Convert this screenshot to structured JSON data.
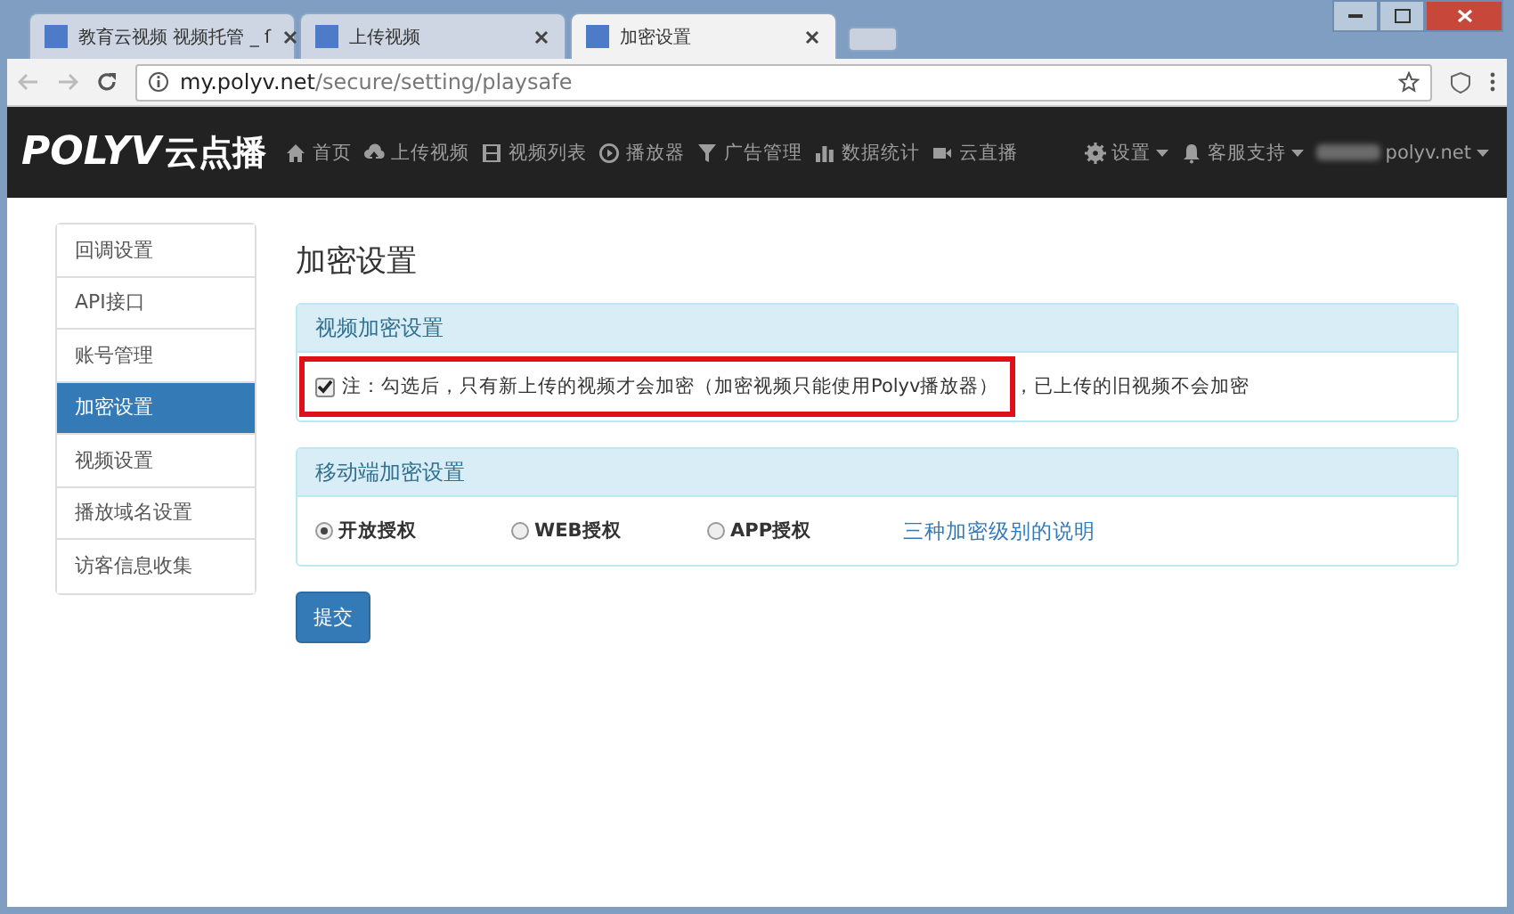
{
  "browser": {
    "tabs": [
      {
        "title": "教育云视频 视频托管 _ ſ",
        "selected": false
      },
      {
        "title": "上传视频",
        "selected": false
      },
      {
        "title": "加密设置",
        "selected": true
      }
    ],
    "address": {
      "host": "my.polyv.net",
      "path": "/secure/setting/playsafe"
    }
  },
  "navbar": {
    "logo": "POLYV",
    "logo_suffix": "云点播",
    "items": [
      {
        "label": "首页"
      },
      {
        "label": "上传视频"
      },
      {
        "label": "视频列表"
      },
      {
        "label": "播放器"
      },
      {
        "label": "广告管理"
      },
      {
        "label": "数据统计"
      },
      {
        "label": "云直播"
      }
    ],
    "right": [
      {
        "label": "设置"
      },
      {
        "label": "客服支持"
      },
      {
        "label": "polyv.net"
      }
    ]
  },
  "sidebar": {
    "items": [
      {
        "label": "回调设置",
        "selected": false
      },
      {
        "label": "API接口",
        "selected": false
      },
      {
        "label": "账号管理",
        "selected": false
      },
      {
        "label": "加密设置",
        "selected": true
      },
      {
        "label": "视频设置",
        "selected": false
      },
      {
        "label": "播放域名设置",
        "selected": false
      },
      {
        "label": "访客信息收集",
        "selected": false
      }
    ]
  },
  "page_title": "加密设置",
  "panels": [
    {
      "title": "视频加密设置",
      "kind": "checkbox",
      "checked": true,
      "highlighted": true,
      "note": "注：勾选后，只有新上传的视频才会加密（加密视频只能使用Polyv播放器）",
      "note_rest": "，已上传的旧视频不会加密"
    },
    {
      "title": "移动端加密设置",
      "kind": "radios",
      "options": [
        {
          "label": "开放授权",
          "selected": true
        },
        {
          "label": "WEB授权",
          "selected": false
        },
        {
          "label": "APP授权",
          "selected": false
        }
      ],
      "link": "三种加密级别的说明"
    }
  ],
  "submit": "提交"
}
